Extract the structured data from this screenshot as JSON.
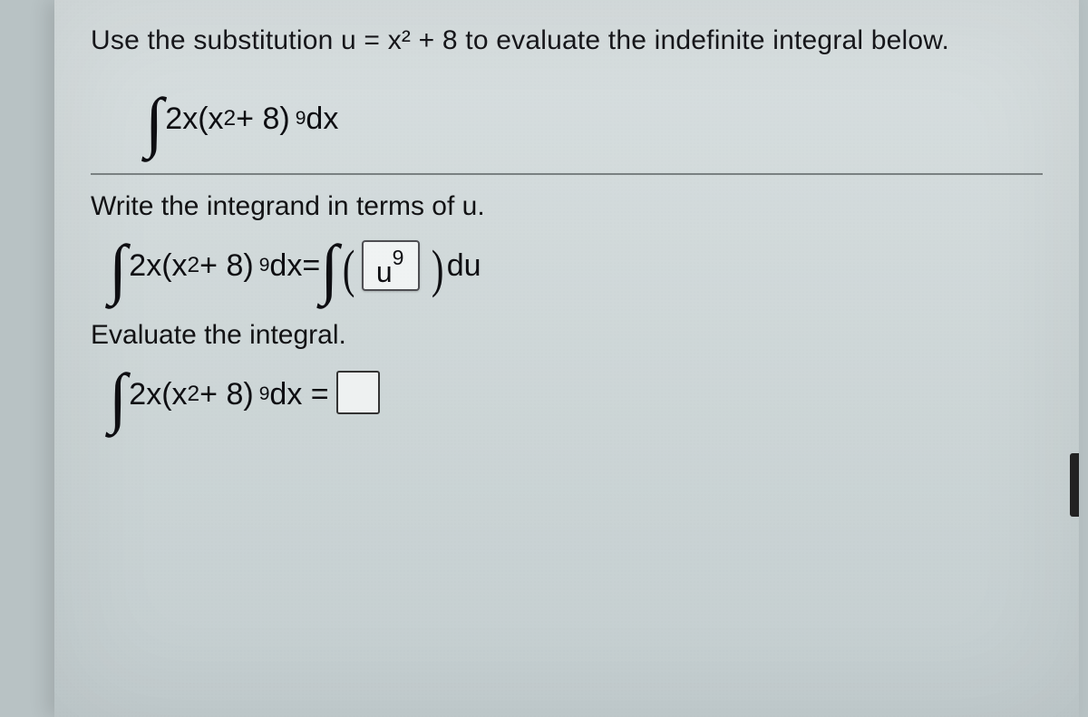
{
  "instruction": "Use the substitution u = x² + 8 to evaluate the indefinite integral below.",
  "integral": {
    "coef": "2x",
    "lparen": "(",
    "inner": "x",
    "inner_exp": "2",
    "plus": " + 8",
    "rparen": ")",
    "exp": "9",
    "dx": " dx"
  },
  "part1": {
    "prompt": "Write the integrand in terms of u.",
    "equals": " = ",
    "u_base": "u",
    "u_exp": "9",
    "du": " du"
  },
  "part2": {
    "prompt": "Evaluate the integral.",
    "equals": " dx = "
  }
}
